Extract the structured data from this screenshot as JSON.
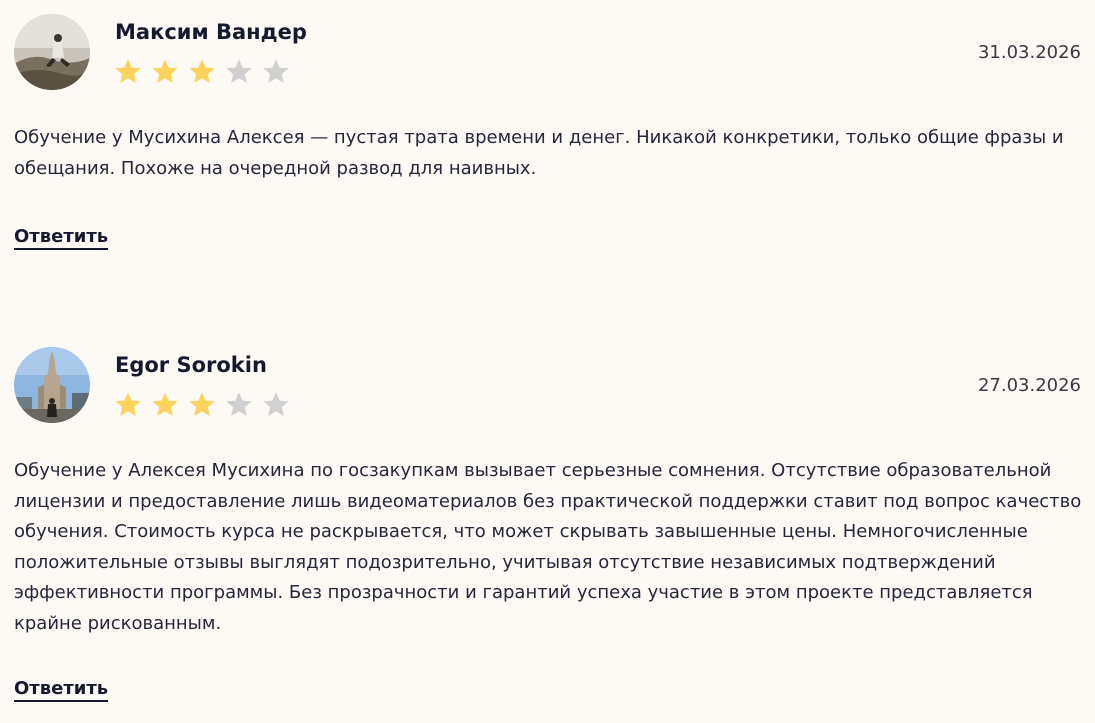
{
  "reviews": [
    {
      "author": "Максим Вандер",
      "date": "31.03.2026",
      "rating": 3,
      "max_rating": 5,
      "text": "Обучение у Мусихина Алексея — пустая трата времени и денег. Никакой конкретики, только общие фразы и обещания. Похоже на очередной развод для наивных.",
      "reply_label": "Ответить"
    },
    {
      "author": "Egor Sorokin",
      "date": "27.03.2026",
      "rating": 3,
      "max_rating": 5,
      "text": "Обучение у Алексея Мусихина по госзакупкам вызывает серьезные сомнения. Отсутствие образовательной лицензии и предоставление лишь видеоматериалов без практической поддержки ставит под вопрос качество обучения. Стоимость курса не раскрывается, что может скрывать завышенные цены. Немногочисленные положительные отзывы выглядят подозрительно, учитывая отсутствие независимых подтверждений эффективности программы. Без прозрачности и гарантий успеха участие в этом проекте представляется крайне рискованным.",
      "reply_label": "Ответить"
    }
  ],
  "colors": {
    "star_filled": "#fdd35c",
    "star_empty": "#d0d0d0",
    "background": "#fdfaf6",
    "text": "#26263a"
  }
}
